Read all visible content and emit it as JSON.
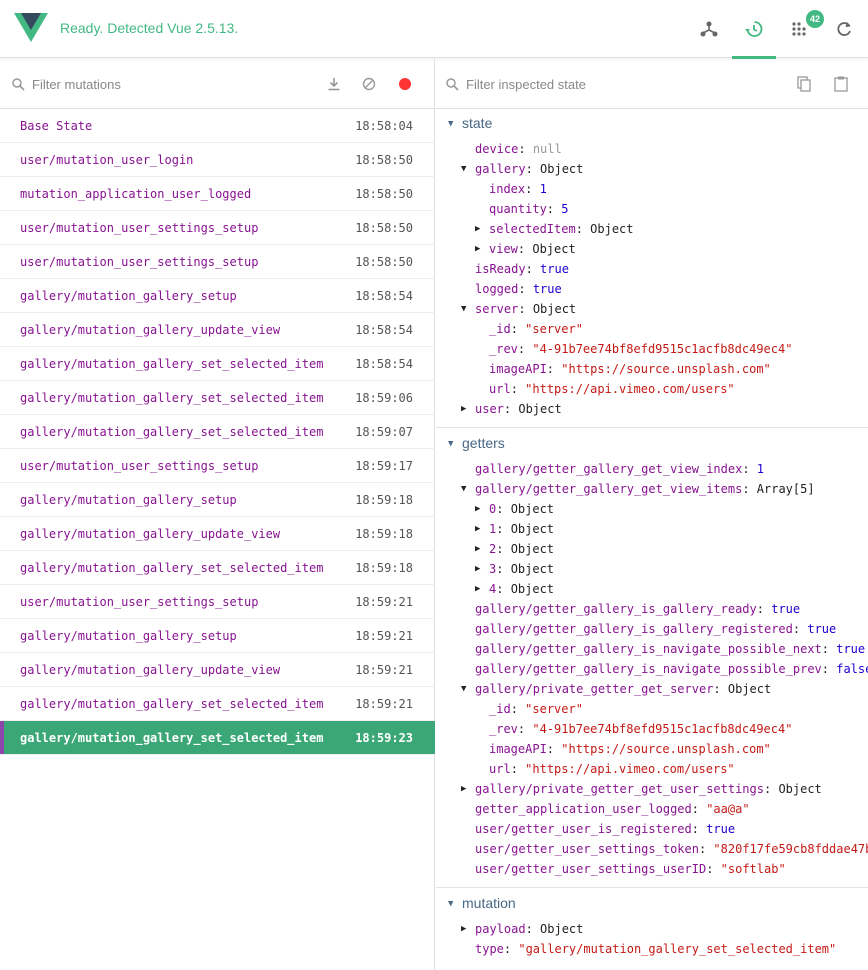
{
  "header": {
    "status": "Ready. Detected Vue 2.5.13.",
    "badge": "42",
    "accent": "#42b983"
  },
  "left": {
    "filter_placeholder": "Filter mutations",
    "icons": [
      "download-icon",
      "block-icon",
      "record-icon"
    ],
    "mutations": [
      {
        "name": "Base State",
        "time": "18:58:04"
      },
      {
        "name": "user/mutation_user_login",
        "time": "18:58:50"
      },
      {
        "name": "mutation_application_user_logged",
        "time": "18:58:50"
      },
      {
        "name": "user/mutation_user_settings_setup",
        "time": "18:58:50"
      },
      {
        "name": "user/mutation_user_settings_setup",
        "time": "18:58:50"
      },
      {
        "name": "gallery/mutation_gallery_setup",
        "time": "18:58:54"
      },
      {
        "name": "gallery/mutation_gallery_update_view",
        "time": "18:58:54"
      },
      {
        "name": "gallery/mutation_gallery_set_selected_item",
        "time": "18:58:54"
      },
      {
        "name": "gallery/mutation_gallery_set_selected_item",
        "time": "18:59:06"
      },
      {
        "name": "gallery/mutation_gallery_set_selected_item",
        "time": "18:59:07"
      },
      {
        "name": "user/mutation_user_settings_setup",
        "time": "18:59:17"
      },
      {
        "name": "gallery/mutation_gallery_setup",
        "time": "18:59:18"
      },
      {
        "name": "gallery/mutation_gallery_update_view",
        "time": "18:59:18"
      },
      {
        "name": "gallery/mutation_gallery_set_selected_item",
        "time": "18:59:18"
      },
      {
        "name": "user/mutation_user_settings_setup",
        "time": "18:59:21"
      },
      {
        "name": "gallery/mutation_gallery_setup",
        "time": "18:59:21"
      },
      {
        "name": "gallery/mutation_gallery_update_view",
        "time": "18:59:21"
      },
      {
        "name": "gallery/mutation_gallery_set_selected_item",
        "time": "18:59:21"
      },
      {
        "name": "gallery/mutation_gallery_set_selected_item",
        "time": "18:59:23",
        "active": true
      }
    ]
  },
  "right": {
    "filter_placeholder": "Filter inspected state",
    "sections": [
      {
        "title": "state",
        "nodes": [
          {
            "d": 0,
            "key": "device",
            "val": "null",
            "t": "null"
          },
          {
            "d": 0,
            "key": "gallery",
            "val": "Object",
            "t": "type",
            "open": true
          },
          {
            "d": 1,
            "key": "index",
            "val": "1",
            "t": "num"
          },
          {
            "d": 1,
            "key": "quantity",
            "val": "5",
            "t": "num"
          },
          {
            "d": 1,
            "key": "selectedItem",
            "val": "Object",
            "t": "type",
            "closed": true
          },
          {
            "d": 1,
            "key": "view",
            "val": "Object",
            "t": "type",
            "closed": true
          },
          {
            "d": 0,
            "key": "isReady",
            "val": "true",
            "t": "bool"
          },
          {
            "d": 0,
            "key": "logged",
            "val": "true",
            "t": "bool"
          },
          {
            "d": 0,
            "key": "server",
            "val": "Object",
            "t": "type",
            "open": true
          },
          {
            "d": 1,
            "key": "_id",
            "val": "\"server\"",
            "t": "str"
          },
          {
            "d": 1,
            "key": "_rev",
            "val": "\"4-91b7ee74bf8efd9515c1acfb8dc49ec4\"",
            "t": "str"
          },
          {
            "d": 1,
            "key": "imageAPI",
            "val": "\"https://source.unsplash.com\"",
            "t": "str"
          },
          {
            "d": 1,
            "key": "url",
            "val": "\"https://api.vimeo.com/users\"",
            "t": "str"
          },
          {
            "d": 0,
            "key": "user",
            "val": "Object",
            "t": "type",
            "closed": true
          }
        ]
      },
      {
        "title": "getters",
        "nodes": [
          {
            "d": 0,
            "key": "gallery/getter_gallery_get_view_index",
            "val": "1",
            "t": "num"
          },
          {
            "d": 0,
            "key": "gallery/getter_gallery_get_view_items",
            "val": "Array[5]",
            "t": "type",
            "open": true
          },
          {
            "d": 1,
            "key": "0",
            "val": "Object",
            "t": "type",
            "closed": true
          },
          {
            "d": 1,
            "key": "1",
            "val": "Object",
            "t": "type",
            "closed": true
          },
          {
            "d": 1,
            "key": "2",
            "val": "Object",
            "t": "type",
            "closed": true
          },
          {
            "d": 1,
            "key": "3",
            "val": "Object",
            "t": "type",
            "closed": true
          },
          {
            "d": 1,
            "key": "4",
            "val": "Object",
            "t": "type",
            "closed": true
          },
          {
            "d": 0,
            "key": "gallery/getter_gallery_is_gallery_ready",
            "val": "true",
            "t": "bool"
          },
          {
            "d": 0,
            "key": "gallery/getter_gallery_is_gallery_registered",
            "val": "true",
            "t": "bool"
          },
          {
            "d": 0,
            "key": "gallery/getter_gallery_is_navigate_possible_next",
            "val": "true",
            "t": "bool"
          },
          {
            "d": 0,
            "key": "gallery/getter_gallery_is_navigate_possible_prev",
            "val": "false",
            "t": "bool"
          },
          {
            "d": 0,
            "key": "gallery/private_getter_get_server",
            "val": "Object",
            "t": "type",
            "open": true
          },
          {
            "d": 1,
            "key": "_id",
            "val": "\"server\"",
            "t": "str"
          },
          {
            "d": 1,
            "key": "_rev",
            "val": "\"4-91b7ee74bf8efd9515c1acfb8dc49ec4\"",
            "t": "str"
          },
          {
            "d": 1,
            "key": "imageAPI",
            "val": "\"https://source.unsplash.com\"",
            "t": "str"
          },
          {
            "d": 1,
            "key": "url",
            "val": "\"https://api.vimeo.com/users\"",
            "t": "str"
          },
          {
            "d": 0,
            "key": "gallery/private_getter_get_user_settings",
            "val": "Object",
            "t": "type",
            "closed": true
          },
          {
            "d": 0,
            "key": "getter_application_user_logged",
            "val": "\"aa@a\"",
            "t": "str"
          },
          {
            "d": 0,
            "key": "user/getter_user_is_registered",
            "val": "true",
            "t": "bool"
          },
          {
            "d": 0,
            "key": "user/getter_user_settings_token",
            "val": "\"820f17fe59cb8fddae47b",
            "t": "str"
          },
          {
            "d": 0,
            "key": "user/getter_user_settings_userID",
            "val": "\"softlab\"",
            "t": "str"
          }
        ]
      },
      {
        "title": "mutation",
        "nodes": [
          {
            "d": 0,
            "key": "payload",
            "val": "Object",
            "t": "type",
            "closed": true
          },
          {
            "d": 0,
            "key": "type",
            "val": "\"gallery/mutation_gallery_set_selected_item\"",
            "t": "str"
          }
        ]
      }
    ]
  }
}
